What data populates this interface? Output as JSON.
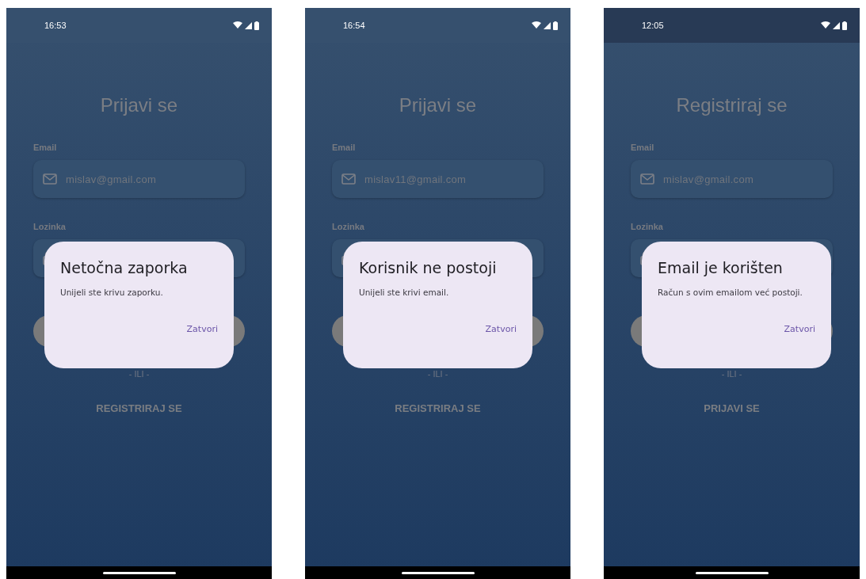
{
  "screens": [
    {
      "status_bar": {
        "time": "16:53",
        "dark": false
      },
      "title": "Prijavi se",
      "email_label": "Email",
      "email_value": "mislav@gmail.com",
      "password_label": "Lozinka",
      "divider": "- ILI -",
      "link": "REGISTRIRAJ SE",
      "dialog": {
        "title": "Netočna zaporka",
        "message": "Unijeli ste krivu zaporku.",
        "action": "Zatvori"
      }
    },
    {
      "status_bar": {
        "time": "16:54",
        "dark": false
      },
      "title": "Prijavi se",
      "email_label": "Email",
      "email_value": "mislav11@gmail.com",
      "password_label": "Lozinka",
      "divider": "- ILI -",
      "link": "REGISTRIRAJ SE",
      "dialog": {
        "title": "Korisnik ne postoji",
        "message": "Unijeli ste krivi email.",
        "action": "Zatvori"
      }
    },
    {
      "status_bar": {
        "time": "12:05",
        "dark": true
      },
      "title": "Registriraj se",
      "email_label": "Email",
      "email_value": "mislav@gmail.com",
      "password_label": "Lozinka",
      "divider": "- ILI -",
      "link": "PRIJAVI SE",
      "dialog": {
        "title": "Email je korišten",
        "message": "Račun s ovim emailom već postoji.",
        "action": "Zatvori"
      }
    }
  ]
}
